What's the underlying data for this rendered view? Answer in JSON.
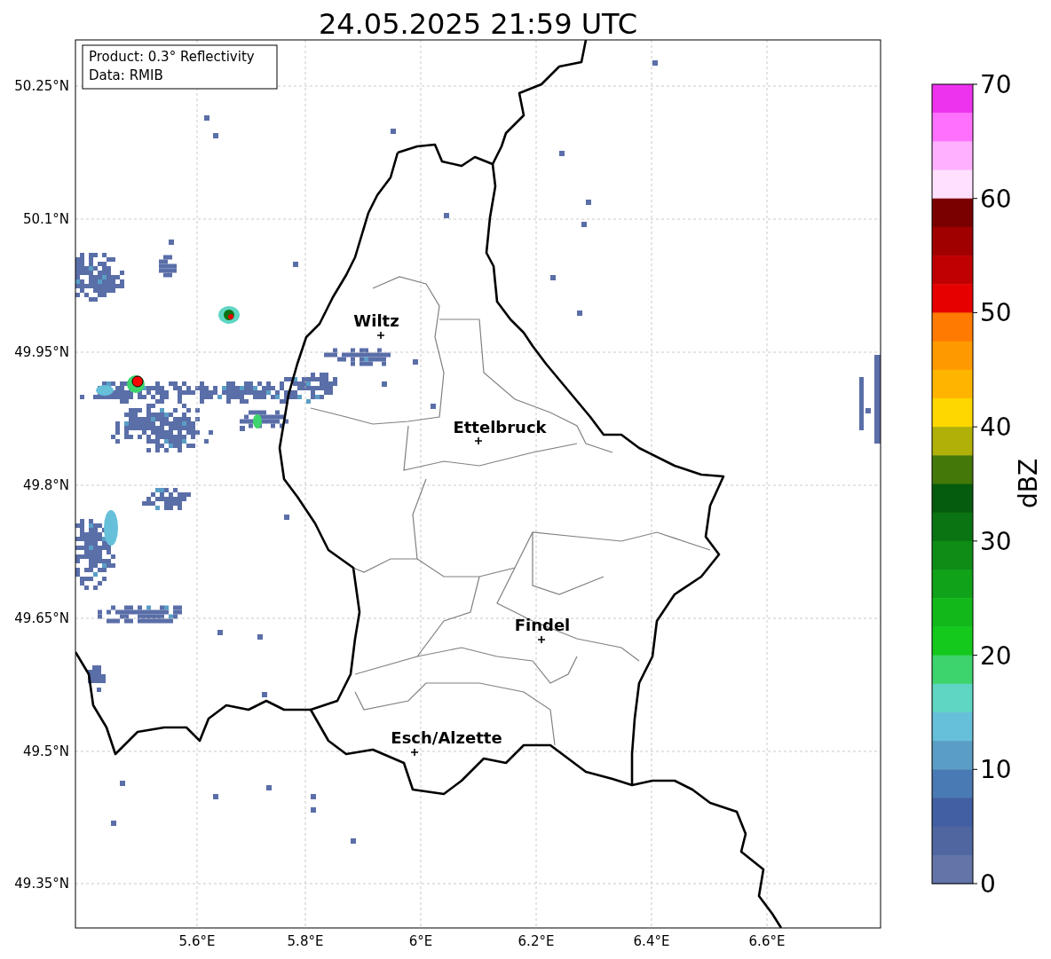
{
  "title": "24.05.2025 21:59 UTC",
  "info_box": [
    "Product: 0.3° Reflectivity",
    "Data: RMIB"
  ],
  "y_ticks": [
    "50.25°N",
    "50.1°N",
    "49.95°N",
    "49.8°N",
    "49.65°N",
    "49.5°N",
    "49.35°N"
  ],
  "x_ticks": [
    "5.6°E",
    "5.8°E",
    "6°E",
    "6.2°E",
    "6.4°E",
    "6.6°E"
  ],
  "cities": [
    {
      "name": "Wiltz"
    },
    {
      "name": "Ettelbruck"
    },
    {
      "name": "Findel"
    },
    {
      "name": "Esch/Alzette"
    }
  ],
  "colorbar": {
    "label": "dBZ",
    "ticks": [
      "70",
      "60",
      "50",
      "40",
      "30",
      "20",
      "10",
      "0"
    ],
    "bins": [
      {
        "color": "#ee33ee"
      },
      {
        "color": "#ff70ff"
      },
      {
        "color": "#ffb0ff"
      },
      {
        "color": "#ffe0ff"
      },
      {
        "color": "#7a0000"
      },
      {
        "color": "#a00000"
      },
      {
        "color": "#c00000"
      },
      {
        "color": "#e60000"
      },
      {
        "color": "#ff7a00"
      },
      {
        "color": "#ff9900"
      },
      {
        "color": "#ffb400"
      },
      {
        "color": "#ffd700"
      },
      {
        "color": "#b0b008"
      },
      {
        "color": "#447808"
      },
      {
        "color": "#065c0e"
      },
      {
        "color": "#0a7412"
      },
      {
        "color": "#0e8c16"
      },
      {
        "color": "#10a218"
      },
      {
        "color": "#12b81a"
      },
      {
        "color": "#14c81c"
      },
      {
        "color": "#3dd46d"
      },
      {
        "color": "#5fd6c3"
      },
      {
        "color": "#66c0da"
      },
      {
        "color": "#5a9ec6"
      },
      {
        "color": "#4a7ab3"
      },
      {
        "color": "#435fa3"
      },
      {
        "color": "#4f66a0"
      },
      {
        "color": "#6474a8"
      }
    ]
  }
}
